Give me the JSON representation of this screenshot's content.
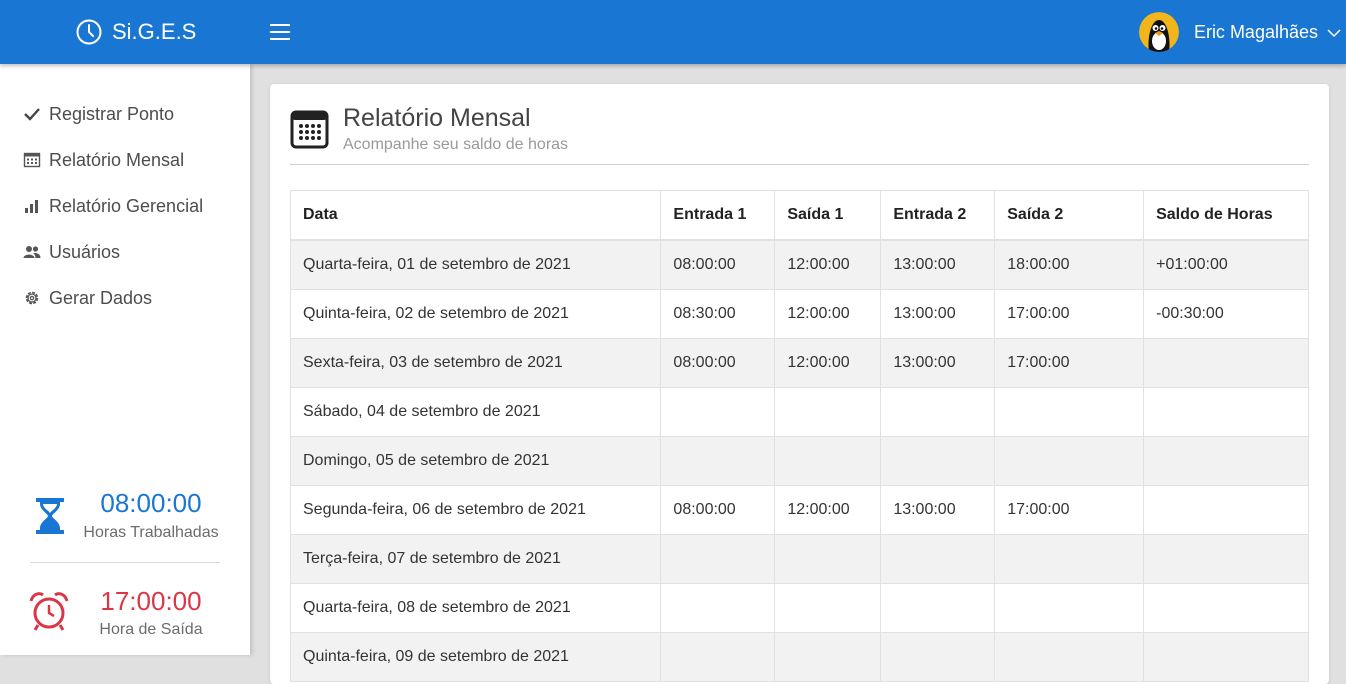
{
  "header": {
    "brand": "Si.G.E.S",
    "user_name": "Eric Magalhães"
  },
  "sidebar": {
    "items": [
      {
        "label": "Registrar Ponto",
        "icon": "check-icon"
      },
      {
        "label": "Relatório Mensal",
        "icon": "calendar-icon"
      },
      {
        "label": "Relatório Gerencial",
        "icon": "bar-chart-icon"
      },
      {
        "label": "Usuários",
        "icon": "users-icon"
      },
      {
        "label": "Gerar Dados",
        "icon": "gear-icon"
      }
    ],
    "worked": {
      "value": "08:00:00",
      "label": "Horas Trabalhadas",
      "color": "#1976d2"
    },
    "exit": {
      "value": "17:00:00",
      "label": "Hora de Saída",
      "color": "#dc3545"
    }
  },
  "main": {
    "title": "Relatório Mensal",
    "subtitle": "Acompanhe seu saldo de horas",
    "columns": [
      "Data",
      "Entrada 1",
      "Saída 1",
      "Entrada 2",
      "Saída 2",
      "Saldo de Horas"
    ],
    "rows": [
      [
        "Quarta-feira, 01 de setembro de 2021",
        "08:00:00",
        "12:00:00",
        "13:00:00",
        "18:00:00",
        "+01:00:00"
      ],
      [
        "Quinta-feira, 02 de setembro de 2021",
        "08:30:00",
        "12:00:00",
        "13:00:00",
        "17:00:00",
        "-00:30:00"
      ],
      [
        "Sexta-feira, 03 de setembro de 2021",
        "08:00:00",
        "12:00:00",
        "13:00:00",
        "17:00:00",
        ""
      ],
      [
        "Sábado, 04 de setembro de 2021",
        "",
        "",
        "",
        "",
        ""
      ],
      [
        "Domingo, 05 de setembro de 2021",
        "",
        "",
        "",
        "",
        ""
      ],
      [
        "Segunda-feira, 06 de setembro de 2021",
        "08:00:00",
        "12:00:00",
        "13:00:00",
        "17:00:00",
        ""
      ],
      [
        "Terça-feira, 07 de setembro de 2021",
        "",
        "",
        "",
        "",
        ""
      ],
      [
        "Quarta-feira, 08 de setembro de 2021",
        "",
        "",
        "",
        "",
        ""
      ],
      [
        "Quinta-feira, 09 de setembro de 2021",
        "",
        "",
        "",
        "",
        ""
      ]
    ]
  },
  "colors": {
    "primary": "#1976d2",
    "danger": "#dc3545"
  }
}
